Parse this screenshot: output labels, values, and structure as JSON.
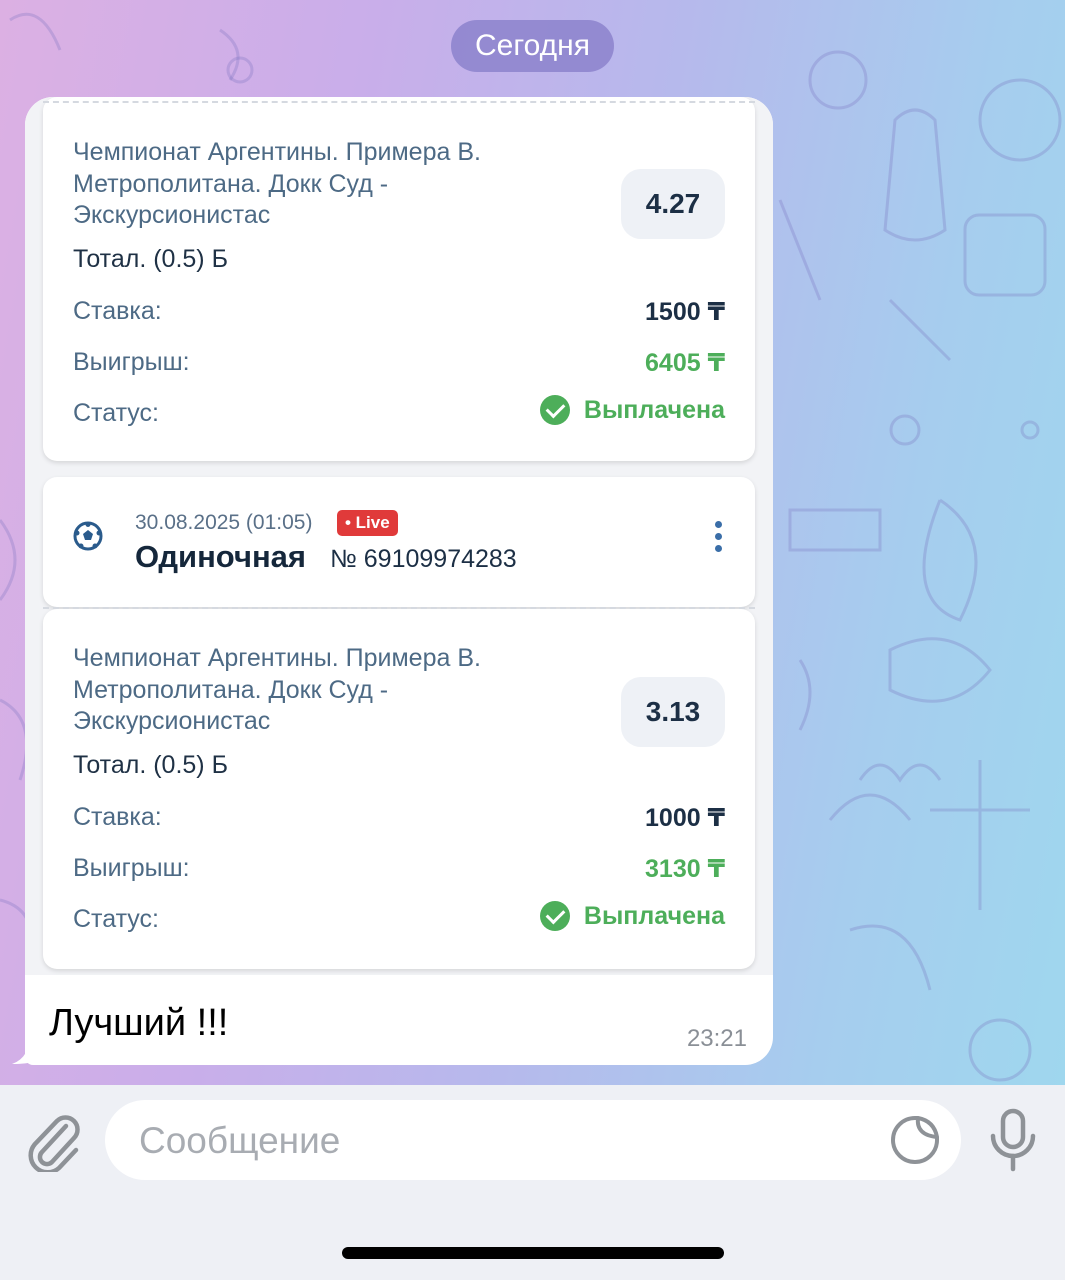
{
  "chat": {
    "date_label": "Сегодня",
    "message": {
      "text": "Лучший !!!",
      "time": "23:21"
    }
  },
  "bets": [
    {
      "event": "Чемпионат Аргентины. Примера В. Метрополитана. Докк Суд - Экскурсионистас",
      "market": "Тотал. (0.5) Б",
      "odds": "4.27",
      "stake_label": "Ставка:",
      "stake": "1500 ₸",
      "win_label": "Выигрыш:",
      "win": "6405 ₸",
      "status_label": "Статус:",
      "status": "Выплачена"
    },
    {
      "date": "30.08.2025 (01:05)",
      "live_badge": "• Live",
      "type": "Одиночная",
      "number": "№ 69109974283",
      "event": "Чемпионат Аргентины. Примера В. Метрополитана. Докк Суд - Экскурсионистас",
      "market": "Тотал. (0.5) Б",
      "odds": "3.13",
      "stake_label": "Ставка:",
      "stake": "1000 ₸",
      "win_label": "Выигрыш:",
      "win": "3130 ₸",
      "status_label": "Статус:",
      "status": "Выплачена"
    }
  ],
  "input": {
    "placeholder": "Сообщение"
  },
  "icons": {
    "attach": "paperclip-icon",
    "sticker": "sticker-icon",
    "mic": "microphone-icon",
    "ball": "soccer-ball-icon",
    "menu": "more-vertical-icon",
    "status": "check-circle-icon"
  },
  "colors": {
    "status_green": "#4dae5a",
    "live_red": "#e03a3a",
    "event_text": "#4d6a85"
  }
}
